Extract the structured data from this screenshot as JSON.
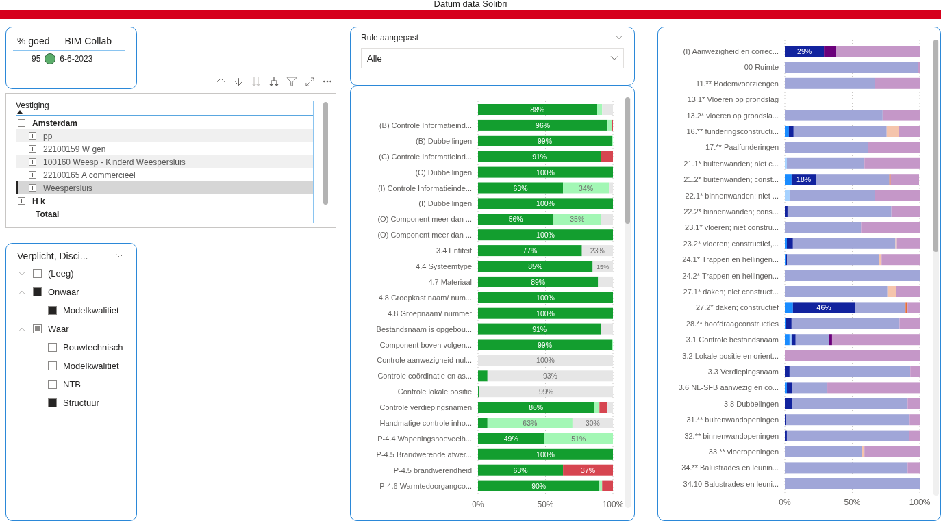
{
  "report_title": "Datum data Solibri",
  "kpi_table": {
    "columns": [
      "% goed",
      "BIM Collab"
    ],
    "row": {
      "score": "95",
      "color": "#5aad6a",
      "date": "6-6-2023"
    }
  },
  "matrix": {
    "column": "Vestiging",
    "groups": [
      {
        "label": "Amsterdam",
        "expanded": true,
        "rows": [
          {
            "text": "pp",
            "expanded": false,
            "selected": false
          },
          {
            "text": "22100159 W gen",
            "expanded": false,
            "selected": false
          },
          {
            "text": "100160 Weesp - Kinderd Weespersluis",
            "expanded": false,
            "selected": false
          },
          {
            "text": "22100165 A commercieel",
            "expanded": false,
            "selected": false
          },
          {
            "text": "Weespersluis",
            "expanded": false,
            "selected": true
          }
        ]
      },
      {
        "label": "H k",
        "expanded": false
      }
    ],
    "total": "Totaal"
  },
  "slicer_discipline": {
    "title": "Verplicht, Disci...",
    "items": [
      {
        "label": "(Leeg)",
        "expanded": false,
        "checked": false,
        "partial": false
      },
      {
        "label": "Onwaar",
        "expanded": true,
        "checked": true,
        "partial": false,
        "children": [
          {
            "label": "Modelkwalitiet",
            "checked": true
          }
        ]
      },
      {
        "label": "Waar",
        "expanded": true,
        "checked": false,
        "partial": true,
        "children": [
          {
            "label": "Bouwtechnisch",
            "checked": false
          },
          {
            "label": "Modelkwalitiet",
            "checked": false
          },
          {
            "label": "NTB",
            "checked": false
          },
          {
            "label": "Structuur",
            "checked": true
          }
        ]
      }
    ]
  },
  "slicer_rule": {
    "title": "Rule aangepast",
    "value": "Alle"
  },
  "chart_rules": {
    "chart_data": {
      "type": "bar",
      "orientation": "horizontal",
      "stacked": true,
      "xlim": [
        0,
        100
      ],
      "xticks": [
        {
          "value": 0,
          "label": "0%"
        },
        {
          "value": 50,
          "label": "50%"
        },
        {
          "value": 100,
          "label": "100%"
        }
      ],
      "categories": [
        null,
        "(B) Controle Informatieind...",
        "(B) Dubbellingen",
        "(C) Controle Informatieind...",
        "(C) Dubbellingen",
        "(I) Controle Informatieinde...",
        "(I) Dubbellingen",
        "(O) Component meer dan ...",
        "(O) Component meer dan ...",
        "3.4 Entiteit",
        "4.4 Systeemtype",
        "4.7 Materiaal",
        "4.8 Groepkast naam/ num...",
        "4.8 Groepnaam/ nummer",
        "Bestandsnaam is opgebou...",
        "Component boven volgen...",
        "Controle aanwezigheid nul...",
        "Controle coördinatie en as...",
        "Controle lokale positie",
        "Controle verdiepingsnamen",
        "Handmatige controle inho...",
        "P-4.4 Wapeningshoeveelh...",
        "P-4.5 Brandwerende afwer...",
        "P-4.5 brandwerendheid",
        "P-4.6 Warmtedoorgangco..."
      ],
      "series": [
        {
          "color": "#139e2f",
          "values": [
            88,
            96,
            99,
            91,
            100,
            63,
            100,
            56,
            100,
            77,
            85,
            89,
            100,
            100,
            91,
            99,
            0,
            7,
            1,
            86,
            7,
            49,
            100,
            63,
            90
          ],
          "value_labels": [
            "88%",
            "96%",
            "99%",
            "91%",
            "100%",
            "63%",
            "100%",
            "56%",
            "100%",
            "77%",
            "85%",
            "89%",
            "100%",
            "100%",
            "91%",
            "99%",
            null,
            null,
            null,
            "86%",
            null,
            "49%",
            "100%",
            "63%",
            "90%"
          ]
        },
        {
          "color": "#a3f7b5",
          "values": [
            4,
            3,
            1,
            0,
            0,
            34,
            0,
            35,
            0,
            0,
            0,
            0,
            0,
            0,
            0,
            1,
            0,
            0,
            0,
            4,
            63,
            51,
            0,
            0,
            2
          ],
          "value_labels": [
            null,
            null,
            null,
            null,
            null,
            "34%",
            null,
            "35%",
            null,
            null,
            null,
            null,
            null,
            null,
            null,
            null,
            null,
            null,
            null,
            null,
            "63%",
            "51%",
            null,
            null,
            null
          ]
        },
        {
          "color": "#d64550",
          "values": [
            0,
            1,
            0,
            9,
            0,
            0,
            0,
            0,
            0,
            0,
            0,
            0,
            0,
            0,
            0,
            0,
            0,
            0,
            0,
            6,
            0,
            0,
            0,
            37,
            8
          ],
          "value_labels": [
            null,
            null,
            null,
            null,
            null,
            null,
            null,
            null,
            null,
            null,
            null,
            null,
            null,
            null,
            null,
            null,
            null,
            null,
            null,
            null,
            null,
            null,
            null,
            "37%",
            null
          ]
        },
        {
          "color": "#e6e6e6",
          "values": [
            8,
            0,
            0,
            0,
            0,
            3,
            0,
            9,
            0,
            23,
            15,
            11,
            0,
            0,
            9,
            0,
            100,
            93,
            99,
            4,
            30,
            0,
            0,
            0,
            0
          ],
          "value_labels": [
            null,
            null,
            null,
            null,
            null,
            null,
            null,
            null,
            null,
            "23%",
            "15%",
            null,
            null,
            null,
            null,
            null,
            "100%",
            "93%",
            "99%",
            null,
            "30%",
            null,
            null,
            null,
            null
          ]
        }
      ]
    }
  },
  "chart_components": {
    "chart_data": {
      "type": "bar",
      "orientation": "horizontal",
      "stacked": true,
      "xlim": [
        0,
        100
      ],
      "xticks": [
        {
          "value": 0,
          "label": "0%"
        },
        {
          "value": 50,
          "label": "50%"
        },
        {
          "value": 100,
          "label": "100%"
        }
      ],
      "categories": [
        "(I) Aanwezigheid en correc...",
        "00 Ruimte",
        "11.** Bodemvoorziengen",
        "13.1* Vloeren op grondslag",
        "13.2* vloeren op grondsla...",
        "16.** funderingsconstructi...",
        "17.** Paalfunderingen",
        "21.1* buitenwanden; niet c...",
        "21.2* buitenwanden; const...",
        "22.1* binnenwanden; niet ...",
        "22.2* binnenwanden; cons...",
        "23.1* vloeren; niet constru...",
        "23.2* vloeren; constructief,...",
        "24.1* Trappen en hellingen...",
        "24.2* Trappen en hellingen...",
        "27.1* daken; niet construct...",
        "27.2* daken; constructief",
        "28.** hoofdraagconstructies",
        "3.1 Controle bestandsnaam",
        "3.2 Lokale positie en orient...",
        "3.3 Verdiepingsnaam",
        "3.6 NL-SFB aanwezig en co...",
        "3.8 Dubbelingen",
        "31.** buitenwandopeningen",
        "32.** binnenwandopeningen",
        "33.** vloeropeningen",
        "34.** Balustrades en leunin...",
        "34.10 Balustrades en leuni..."
      ],
      "series": [
        {
          "color": "#1a8cff",
          "values": [
            0,
            0,
            0,
            0,
            0,
            3,
            0,
            0,
            5,
            0,
            0,
            0,
            1.5,
            0.7,
            0,
            0,
            6,
            1,
            3.5,
            0,
            0,
            1.5,
            0,
            0,
            0,
            0,
            0,
            0
          ]
        },
        {
          "color": "#a6d2ff",
          "values": [
            0,
            0,
            0,
            0,
            0,
            0,
            0,
            1.5,
            0,
            3.5,
            0,
            0,
            0,
            0,
            0,
            0,
            0,
            0,
            1.5,
            0,
            0,
            0,
            0,
            0,
            0,
            0,
            0,
            0
          ]
        },
        {
          "color": "#12239e",
          "values": [
            29,
            0,
            0,
            0,
            0,
            3.5,
            0,
            0,
            18,
            0,
            2,
            0,
            4.5,
            1,
            0,
            0,
            46,
            4,
            3,
            0,
            3.5,
            4,
            5.5,
            1,
            1.5,
            0,
            0,
            0
          ],
          "value_labels": [
            "29%",
            null,
            null,
            null,
            null,
            null,
            null,
            null,
            "18%",
            null,
            null,
            null,
            null,
            null,
            null,
            null,
            "46%",
            null,
            null,
            null,
            null,
            null,
            null,
            null,
            null,
            null,
            null,
            null
          ]
        },
        {
          "color": "#a0a6d8",
          "values": [
            0,
            99,
            66.5,
            0,
            72.5,
            69,
            61.5,
            57.5,
            54.5,
            63.5,
            77,
            56.5,
            76,
            68,
            100,
            76,
            37.5,
            80,
            25,
            0,
            89.5,
            26,
            85.5,
            91.5,
            90.5,
            57,
            91,
            100
          ]
        },
        {
          "color": "#6b007b",
          "values": [
            9,
            0,
            0,
            0,
            0,
            0,
            0,
            0,
            0,
            0,
            0,
            0,
            0,
            0,
            0,
            0,
            0,
            0,
            2,
            0,
            0,
            0,
            0,
            0,
            0,
            0,
            0,
            0
          ]
        },
        {
          "color": "#f5c4ac",
          "values": [
            0,
            0,
            0,
            0,
            0,
            9,
            0,
            0,
            null,
            0,
            0,
            0,
            1,
            2,
            0,
            6.5,
            0,
            0,
            0,
            0,
            0,
            0,
            0,
            0,
            0,
            2,
            0,
            0
          ]
        },
        {
          "color": "#e66c37",
          "values": [
            0,
            0,
            0,
            0,
            0,
            0,
            0,
            0,
            1,
            0,
            0,
            0,
            0,
            0,
            0,
            0,
            1.5,
            0,
            0,
            0,
            0,
            0,
            0,
            0,
            0,
            0,
            0,
            0
          ]
        },
        {
          "color": "#c597c8",
          "values": [
            62,
            1,
            33.5,
            0,
            27.5,
            15.5,
            38.5,
            41,
            21,
            33,
            21,
            43.5,
            17,
            28.3,
            0,
            17.5,
            9,
            15,
            65,
            100,
            7,
            68.5,
            9,
            7.5,
            8,
            41,
            9,
            0
          ]
        }
      ]
    }
  }
}
